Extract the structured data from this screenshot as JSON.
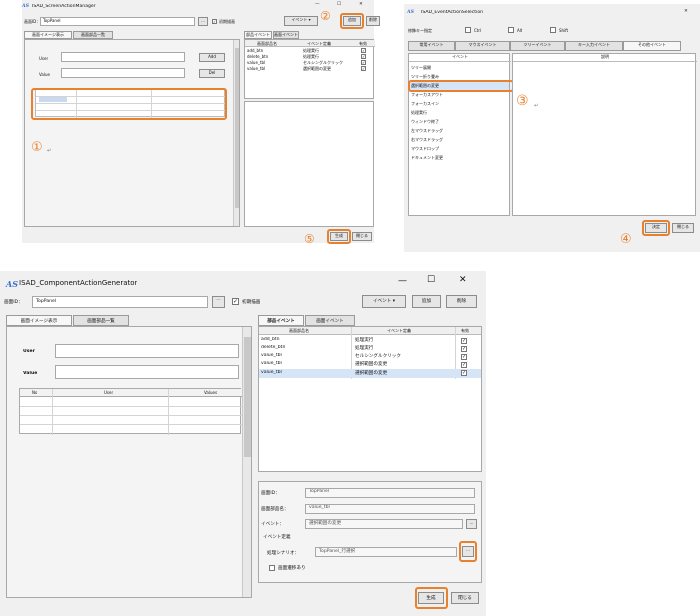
{
  "win_a": {
    "title": "ISAD_ScreenActionManager",
    "screen_id_label": "画面ID：",
    "screen_id_value": "TopPanel",
    "browse_btn": "...",
    "init_check_label": "初期描画",
    "event_dropdown": "イベント",
    "add_btn": "追加",
    "delete_btn": "削除",
    "left_tabs": [
      "画面イメージ表示",
      "画面部品一覧"
    ],
    "right_tabs": [
      "部品イベント",
      "画面イベント"
    ],
    "user_label": "User",
    "value_label": "Value",
    "add_btn_small": "Add",
    "del_btn_small": "Del",
    "event_headers": [
      "画面部品名",
      "イベント定義",
      "有効"
    ],
    "event_rows": [
      {
        "name": "add_btn",
        "event": "処理実行"
      },
      {
        "name": "delete_btn",
        "event": "処理実行"
      },
      {
        "name": "value_tbl",
        "event": "セルシングルクリック"
      },
      {
        "name": "value_tbl",
        "event": "選択範囲の変更"
      }
    ],
    "generate_btn": "生成",
    "close_btn": "閉じる",
    "marker1": "①",
    "marker2": "②",
    "marker5": "⑤"
  },
  "win_b": {
    "title": "ISAD_EventActionSelection",
    "modifier_label": "修飾キー指定",
    "modifiers": [
      "Ctrl",
      "Alt",
      "Shift"
    ],
    "tabs": [
      "常用イベント",
      "マウスイベント",
      "ツリーイベント",
      "キー入力イベント",
      "その他イベント"
    ],
    "col_event": "イベント",
    "col_desc": "説明",
    "events": [
      "ツリー展開",
      "ツリー折り畳み",
      "選択範囲の変更",
      "フォーカスアウト",
      "フォーカスイン",
      "処理実行",
      "ウィンドウ終了",
      "左マウスドラッグ",
      "右マウスドラッグ",
      "マウスドロップ",
      "ドキュメント変更"
    ],
    "ok_btn": "決定",
    "close_btn": "閉じる",
    "marker3": "③",
    "marker4": "④"
  },
  "win_c": {
    "title": "ISAD_ComponentActionGenerator",
    "screen_id_label": "画面ID：",
    "screen_id_value": "TopPanel",
    "browse_btn": "...",
    "init_check_label": "初期描画",
    "event_dropdown": "イベント",
    "add_btn": "追加",
    "delete_btn": "削除",
    "left_tabs": [
      "画面イメージ表示",
      "画面部品一覧"
    ],
    "right_tabs": [
      "部品イベント",
      "画面イベント"
    ],
    "user_label": "User",
    "value_label": "Value",
    "table_headers": [
      "No",
      "User",
      "Values"
    ],
    "event_headers": [
      "画面部品名",
      "イベント定義",
      "有効"
    ],
    "event_rows": [
      {
        "name": "add_btn",
        "event": "処理実行"
      },
      {
        "name": "delete_btn",
        "event": "処理実行"
      },
      {
        "name": "value_tbl",
        "event": "セルシングルクリック"
      },
      {
        "name": "value_tbl",
        "event": "選択範囲の変更"
      },
      {
        "name": "value_tbl",
        "event": "選択範囲の変更"
      }
    ],
    "detail_screen_id_label": "画面ID：",
    "detail_screen_id_value": "TopPanel",
    "detail_part_label": "画面部品名：",
    "detail_part_value": "value_tbl",
    "detail_event_label": "イベント：",
    "detail_event_value": "選択範囲の変更",
    "event_def_label": "イベント定義",
    "scenario_label": "処理シナリオ：",
    "scenario_value": "TopPanel_行選択",
    "screen_transition_label": "画面遷移あり",
    "generate_btn": "生成",
    "close_btn": "閉じる"
  }
}
